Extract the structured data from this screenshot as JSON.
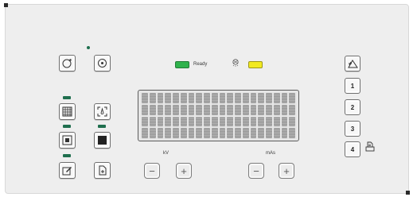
{
  "status": {
    "ready_label": "Ready",
    "ready_color": "#2fb24c",
    "warning_color": "#f2ea22"
  },
  "adjust": {
    "kv_label": "kV",
    "mas_label": "mAs",
    "minus": "−",
    "plus": "+"
  },
  "programs": [
    "1",
    "2",
    "3",
    "4"
  ],
  "icons": {
    "left_top": [
      "circle-dot-icon",
      "target-circle-icon"
    ],
    "left_grid": [
      "grid-filter-icon",
      "focus-spot-icon",
      "square-frame-icon",
      "square-filled-icon",
      "edit-icon",
      "document-plus-icon"
    ],
    "right": [
      "triangle-wave-icon",
      "printer-icon"
    ],
    "status": [
      "radiation-tube-icon"
    ]
  }
}
